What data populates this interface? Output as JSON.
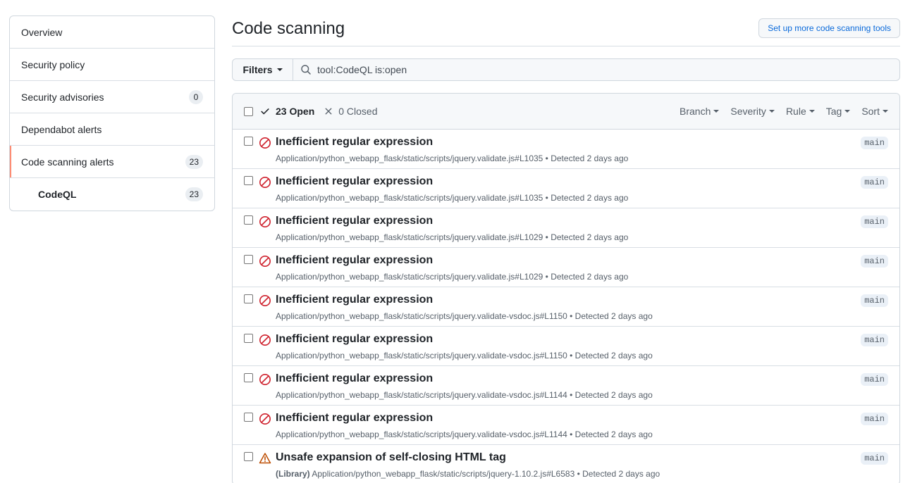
{
  "sidebar": {
    "items": [
      {
        "label": "Overview",
        "count": ""
      },
      {
        "label": "Security policy",
        "count": ""
      },
      {
        "label": "Security advisories",
        "count": "0"
      },
      {
        "label": "Dependabot alerts",
        "count": ""
      },
      {
        "label": "Code scanning alerts",
        "count": "23",
        "selected": true
      },
      {
        "label": "CodeQL",
        "count": "23",
        "sub": true
      }
    ]
  },
  "header": {
    "title": "Code scanning",
    "setup_button": "Set up more code scanning tools"
  },
  "filterbar": {
    "filters_label": "Filters",
    "search_value": "tool:CodeQL is:open"
  },
  "list_header": {
    "open_label": "23 Open",
    "closed_label": "0 Closed",
    "filters": [
      "Branch",
      "Severity",
      "Rule",
      "Tag",
      "Sort"
    ]
  },
  "colors": {
    "error": "#cf222e",
    "warning": "#bc4c00",
    "selected_marker": "#fd8c73",
    "link": "#0969da"
  },
  "alerts": [
    {
      "severity_icon": "stop-icon",
      "title": "Inefficient regular expression",
      "library": "",
      "path": "Application/python_webapp_flask/static/scripts/jquery.validate.js#L1035",
      "detected": "Detected 2 days ago",
      "branch": "main"
    },
    {
      "severity_icon": "stop-icon",
      "title": "Inefficient regular expression",
      "library": "",
      "path": "Application/python_webapp_flask/static/scripts/jquery.validate.js#L1035",
      "detected": "Detected 2 days ago",
      "branch": "main"
    },
    {
      "severity_icon": "stop-icon",
      "title": "Inefficient regular expression",
      "library": "",
      "path": "Application/python_webapp_flask/static/scripts/jquery.validate.js#L1029",
      "detected": "Detected 2 days ago",
      "branch": "main"
    },
    {
      "severity_icon": "stop-icon",
      "title": "Inefficient regular expression",
      "library": "",
      "path": "Application/python_webapp_flask/static/scripts/jquery.validate.js#L1029",
      "detected": "Detected 2 days ago",
      "branch": "main"
    },
    {
      "severity_icon": "stop-icon",
      "title": "Inefficient regular expression",
      "library": "",
      "path": "Application/python_webapp_flask/static/scripts/jquery.validate-vsdoc.js#L1150",
      "detected": "Detected 2 days ago",
      "branch": "main"
    },
    {
      "severity_icon": "stop-icon",
      "title": "Inefficient regular expression",
      "library": "",
      "path": "Application/python_webapp_flask/static/scripts/jquery.validate-vsdoc.js#L1150",
      "detected": "Detected 2 days ago",
      "branch": "main"
    },
    {
      "severity_icon": "stop-icon",
      "title": "Inefficient regular expression",
      "library": "",
      "path": "Application/python_webapp_flask/static/scripts/jquery.validate-vsdoc.js#L1144",
      "detected": "Detected 2 days ago",
      "branch": "main"
    },
    {
      "severity_icon": "stop-icon",
      "title": "Inefficient regular expression",
      "library": "",
      "path": "Application/python_webapp_flask/static/scripts/jquery.validate-vsdoc.js#L1144",
      "detected": "Detected 2 days ago",
      "branch": "main"
    },
    {
      "severity_icon": "alert-icon",
      "title": "Unsafe expansion of self-closing HTML tag",
      "library": "(Library)",
      "path": "Application/python_webapp_flask/static/scripts/jquery-1.10.2.js#L6583",
      "detected": "Detected 2 days ago",
      "branch": "main"
    }
  ]
}
